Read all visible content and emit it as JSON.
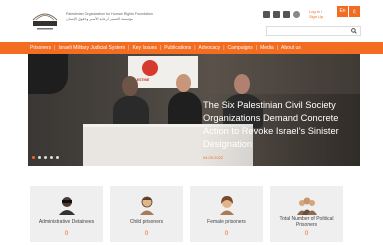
{
  "header": {
    "org_line1": "Palestinian Organization for Human Rights Foundation",
    "org_line2": "مؤسسة الضمير لرعاية الأسير وحقوق الإنسان",
    "login": "Log in / Sign Up",
    "lang_buttons": [
      "En",
      "ع"
    ],
    "search_placeholder": ""
  },
  "nav": {
    "items": [
      "Prisoners",
      "Israeli Military Judicial System",
      "Key Issues",
      "Publications",
      "Advocacy",
      "Campaigns",
      "Media",
      "About us"
    ]
  },
  "hero": {
    "title": "The Six Palestinian Civil Society Organizations Demand Concrete Action to Revoke Israel’s Sinister Designation",
    "date": "04.09.2022",
    "banner_text": "PALESTINE"
  },
  "cards": [
    {
      "label": "Administrative Detainees",
      "value": "0"
    },
    {
      "label": "Child prisoners",
      "value": "0"
    },
    {
      "label": "Female prisoners",
      "value": "0"
    },
    {
      "label": "Total Number of Political Prisoners",
      "value": "0"
    }
  ],
  "colors": {
    "accent": "#f26c21",
    "card_bg": "#efefef"
  },
  "icons": [
    "logo-icon",
    "facebook-icon",
    "twitter-icon",
    "youtube-icon",
    "instagram-icon",
    "search-icon",
    "detainee-icon",
    "child-icon",
    "female-icon",
    "group-icon"
  ]
}
